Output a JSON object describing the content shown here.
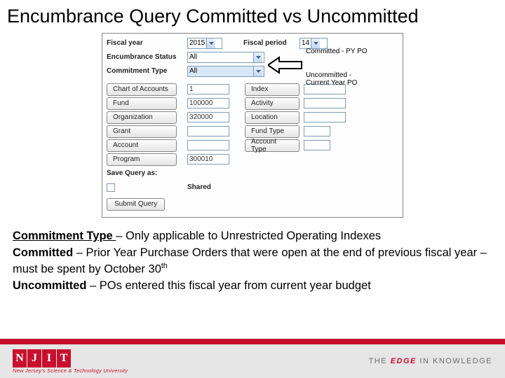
{
  "title": "Encumbrance Query Committed vs Uncommitted",
  "form": {
    "fiscal_year_label": "Fiscal year",
    "fiscal_year_value": "2015",
    "fiscal_period_label": "Fiscal period",
    "fiscal_period_value": "14",
    "enc_status_label": "Encumbrance Status",
    "enc_status_value": "All",
    "commit_type_label": "Commitment Type",
    "commit_type_value": "All",
    "chart_btn": "Chart of Accounts",
    "chart_val": "1",
    "index_btn": "Index",
    "fund_btn": "Fund",
    "fund_val": "100000",
    "activity_btn": "Activity",
    "org_btn": "Organization",
    "org_val": "320000",
    "location_btn": "Location",
    "grant_btn": "Grant",
    "fund_type_btn": "Fund Type",
    "account_btn": "Account",
    "account_type_btn": "Account Type",
    "program_btn": "Program",
    "program_val": "300010",
    "save_label": "Save Query as:",
    "shared_label": "Shared",
    "submit_btn": "Submit Query"
  },
  "annotations": {
    "committed": "Committed - PY PO",
    "uncommitted_l1": "Uncommitted -",
    "uncommitted_l2": "Current Year PO"
  },
  "body": {
    "p1_b": "Commitment Type ",
    "p1_rest": "– Only applicable to Unrestricted Operating Indexes",
    "p2_b": "Committed",
    "p2_rest_a": " – Prior Year Purchase Orders that were open at the end of previous fiscal year – must be spent by October 30",
    "p2_sup": "th",
    "p3_b": "Uncommitted",
    "p3_rest": " – POs entered this fiscal year from current year budget"
  },
  "footer": {
    "njit_letters": [
      "N",
      "J",
      "I",
      "T"
    ],
    "subline": "New Jersey's Science & Technology University",
    "tag_rest": "THE ",
    "tag_edge": "EDGE",
    "tag_rest2": " IN KNOWLEDGE"
  }
}
